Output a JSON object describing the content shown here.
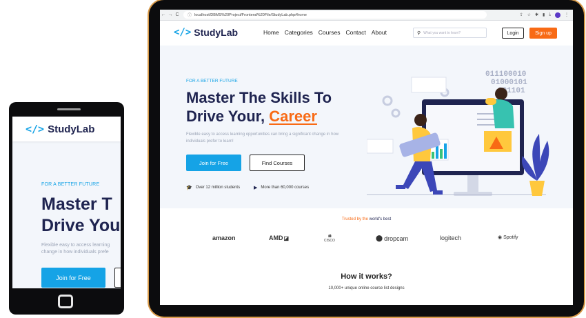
{
  "colors": {
    "accent": "#15a3e6",
    "brand_orange": "#f86a15",
    "navy": "#1f2450"
  },
  "phone": {
    "logo_mark": "</>",
    "logo_text": "StudyLab",
    "eyebrow": "FOR A BETTER FUTURE",
    "headline_line1": "Master T",
    "headline_line2": "Drive You",
    "para_line1": "Flexible easy to access learning",
    "para_line2": "change in how individuals prefe",
    "join_label": "Join for Free"
  },
  "browser": {
    "back_icon": "←",
    "forward_icon": "→",
    "reload_icon": "C",
    "url": "localhost/DBMS%20Project/Frontend%20File/StudyLab.php#home"
  },
  "site": {
    "logo_mark": "</>",
    "logo_text": "StudyLab",
    "menu": [
      "Home",
      "Categories",
      "Courses",
      "Contact",
      "About"
    ],
    "search_placeholder": "What you want to learn?",
    "login_label": "Login",
    "signup_label": "Sign up"
  },
  "hero": {
    "eyebrow": "FOR A BETTER FUTURE",
    "headline_line1": "Master The Skills To",
    "headline_line2_prefix": "Drive Your, ",
    "headline_highlight": "Career",
    "subtext": "Flexible easy to access learning opportunities can bring a significant change in how individuals prefer to learn!",
    "join_label": "Join for Free",
    "find_label": "Find Courses",
    "stat_students": "Over 12 million students",
    "stat_courses": "More than 60,000 courses",
    "binary_lines": [
      "011100010",
      "01000101",
      "001101"
    ]
  },
  "trusted": {
    "prefix": "Trusted by the ",
    "emphasis": "world's best"
  },
  "brands": [
    "amazon",
    "AMD",
    "CISCO",
    "dropcam",
    "logitech",
    "Spotify"
  ],
  "how": {
    "title": "How it works?",
    "subtitle": "10,000+ unique online course list designs"
  }
}
